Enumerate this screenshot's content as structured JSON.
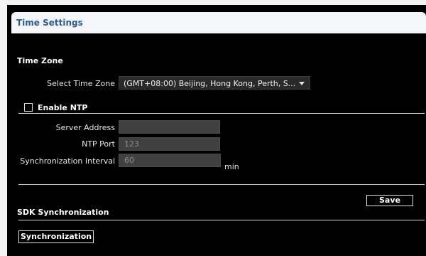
{
  "title": "Time Settings",
  "time_zone": {
    "heading": "Time Zone",
    "select_label": "Select Time Zone",
    "select_value": "(GMT+08:00) Beijing, Hong Kong, Perth, S...",
    "enable_ntp_label": "Enable NTP",
    "enable_ntp_checked": false
  },
  "ntp": {
    "server_label": "Server Address",
    "server_value": "",
    "port_label": "NTP Port",
    "port_value": "123",
    "interval_label": "Synchronization Interval",
    "interval_value": "60",
    "interval_unit": "min"
  },
  "save_label": "Save",
  "sdk": {
    "heading": "SDK Synchronization",
    "button_label": "Synchronization"
  },
  "icons": {
    "dropdown": "chevron-down-icon",
    "checkbox": "checkbox-icon"
  },
  "colors": {
    "title_text": "#2a5d94",
    "panel_bg": "#000000",
    "title_bar_bg": "#f4f6f9"
  }
}
